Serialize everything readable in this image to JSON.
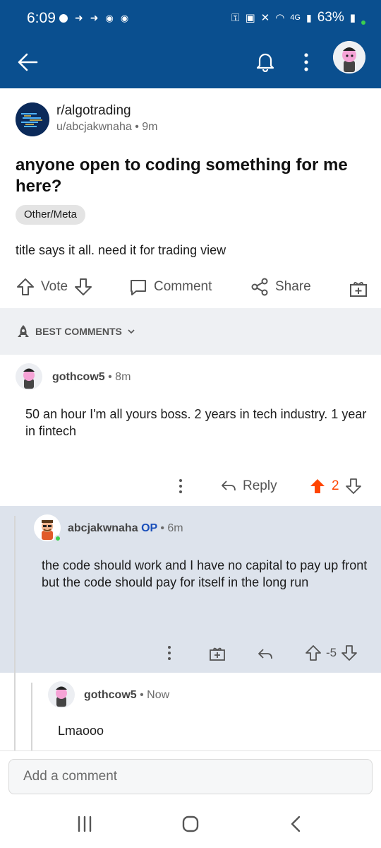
{
  "status_bar": {
    "time": "6:09",
    "battery": "63%",
    "network": "4G"
  },
  "app_bar": {
    "back_icon": "arrow-left-icon",
    "bell_icon": "bell-icon",
    "menu_icon": "kebab-icon"
  },
  "post": {
    "subreddit": "r/algotrading",
    "author": "u/abcjakwnaha",
    "age": "9m",
    "title": "anyone open to coding something for me here?",
    "flair": "Other/Meta",
    "body": "title says it all. need it for trading view"
  },
  "actions": {
    "vote": "Vote",
    "comment": "Comment",
    "share": "Share"
  },
  "sort": {
    "label": "BEST COMMENTS"
  },
  "comments": [
    {
      "author": "gothcow5",
      "age": "8m",
      "body": "50 an hour I'm all yours boss. 2 years in tech industry. 1 year in fintech",
      "reply_label": "Reply",
      "score": "2"
    },
    {
      "author": "abcjakwnaha",
      "op_tag": "OP",
      "age": "6m",
      "body": "the code should work and I have no capital to pay up front but the code should pay for itself in the long run",
      "score": "-5"
    },
    {
      "author": "gothcow5",
      "age": "Now",
      "body": "Lmaooo"
    }
  ],
  "composer": {
    "placeholder": "Add a comment"
  },
  "colors": {
    "brand_blue": "#0a4f8f",
    "upvote_orange": "#ff4500",
    "op_blue": "#1a4fba"
  }
}
